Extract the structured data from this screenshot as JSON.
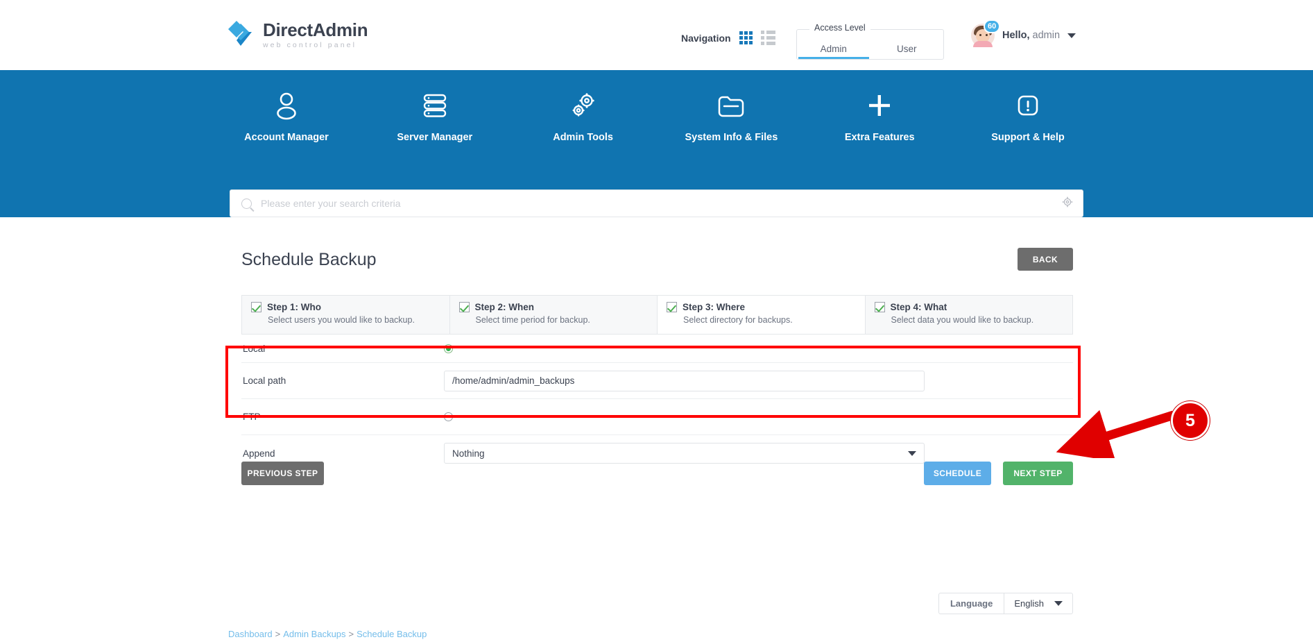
{
  "header": {
    "logo_title_bold": "Direct",
    "logo_title_rest": "Admin",
    "logo_subtitle": "web control panel",
    "nav_label": "Navigation",
    "grid_icon": "grid-view-icon",
    "list_icon": "list-view-icon",
    "access_level_legend": "Access Level",
    "access_tabs": [
      {
        "label": "Admin",
        "active": true
      },
      {
        "label": "User",
        "active": false
      }
    ],
    "user": {
      "badge_count": "60",
      "greeting_bold": "Hello,",
      "greeting_name": "admin",
      "avatar_icon": "user-avatar",
      "caret_icon": "chevron-down-icon"
    }
  },
  "mainnav": {
    "items": [
      {
        "label": "Account Manager",
        "icon": "person-icon"
      },
      {
        "label": "Server Manager",
        "icon": "server-stack-icon"
      },
      {
        "label": "Admin Tools",
        "icon": "gears-icon"
      },
      {
        "label": "System Info & Files",
        "icon": "folder-icon"
      },
      {
        "label": "Extra Features",
        "icon": "plus-icon"
      },
      {
        "label": "Support & Help",
        "icon": "exclamation-box-icon"
      }
    ]
  },
  "search": {
    "placeholder": "Please enter your search criteria",
    "value": "",
    "icon": "search-icon",
    "settings_icon": "gear-icon"
  },
  "page": {
    "title": "Schedule Backup",
    "back_button": "BACK"
  },
  "steps": [
    {
      "title": "Step 1: Who",
      "desc": "Select users you would like to backup.",
      "checked": true,
      "highlight": false
    },
    {
      "title": "Step 2: When",
      "desc": "Select time period for backup.",
      "checked": true,
      "highlight": false
    },
    {
      "title": "Step 3: Where",
      "desc": "Select directory for backups.",
      "checked": true,
      "highlight": true
    },
    {
      "title": "Step 4: What",
      "desc": "Select data you would like to backup.",
      "checked": true,
      "highlight": false
    }
  ],
  "form": {
    "local_label": "Local",
    "local_selected": true,
    "local_path_label": "Local path",
    "local_path_value": "/home/admin/admin_backups",
    "ftp_label": "FTP",
    "ftp_selected": false,
    "append_label": "Append",
    "append_value": "Nothing"
  },
  "buttons": {
    "previous_step": "PREVIOUS STEP",
    "schedule": "SCHEDULE",
    "next_step": "NEXT STEP"
  },
  "footer": {
    "language_label": "Language",
    "language_value": "English",
    "breadcrumb": [
      {
        "label": "Dashboard"
      },
      {
        "label": "Admin Backups"
      },
      {
        "label": "Schedule Backup"
      }
    ],
    "separator": ">"
  },
  "annotation": {
    "step_number": "5",
    "highlight_color": "#ff0000",
    "callout_color": "#e00000"
  },
  "colors": {
    "brand_blue": "#1074b0",
    "accent_blue": "#45b0e8",
    "green": "#52b36a",
    "gray": "#6d6d6d"
  }
}
